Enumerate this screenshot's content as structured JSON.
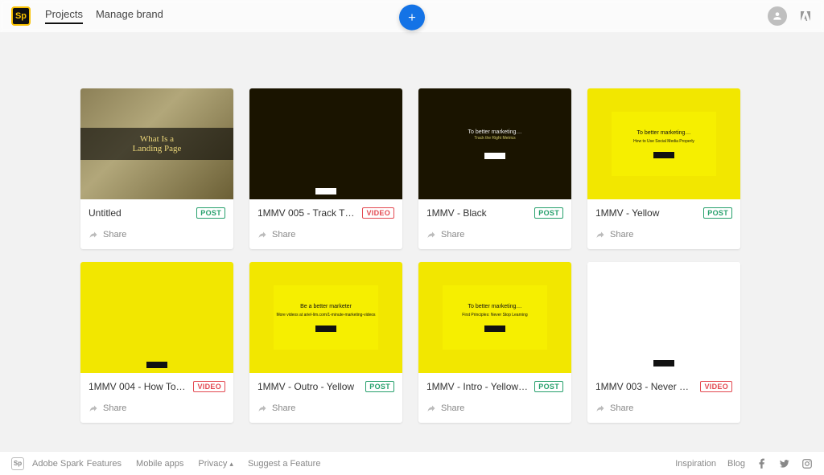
{
  "nav": {
    "logo_text": "Sp",
    "links": [
      "Projects",
      "Manage brand"
    ],
    "active_index": 0
  },
  "projects": [
    {
      "title": "Untitled",
      "badge": "POST",
      "share": "Share",
      "thumb": {
        "variant": "image",
        "heading": "What Is a\nLanding Page"
      }
    },
    {
      "title": "1MMV 005 - Track The…",
      "badge": "VIDEO",
      "share": "Share",
      "thumb": {
        "variant": "black_logo"
      }
    },
    {
      "title": "1MMV - Black",
      "badge": "POST",
      "share": "Share",
      "thumb": {
        "variant": "black_text",
        "heading": "To better marketing…",
        "sub": "Track the Right Metrics"
      }
    },
    {
      "title": "1MMV - Yellow",
      "badge": "POST",
      "share": "Share",
      "thumb": {
        "variant": "yellow_inset",
        "heading": "To better marketing…",
        "sub": "How to Use Social Media Properly"
      }
    },
    {
      "title": "1MMV 004 - How To Use…",
      "badge": "VIDEO",
      "share": "Share",
      "thumb": {
        "variant": "yellow_plain"
      }
    },
    {
      "title": "1MMV - Outro - Yellow",
      "badge": "POST",
      "share": "Share",
      "thumb": {
        "variant": "yellow_inset",
        "heading": "Be a better marketer",
        "sub": "More videos at ariel-lim.com/1-minute-marketing-videos"
      }
    },
    {
      "title": "1MMV - Intro - Yellow…",
      "badge": "POST",
      "share": "Share",
      "thumb": {
        "variant": "yellow_inset",
        "heading": "To better marketing…",
        "sub": "First Principles: Never Stop Learning"
      }
    },
    {
      "title": "1MMV 003 - Never Stop…",
      "badge": "VIDEO",
      "share": "Share",
      "thumb": {
        "variant": "white_logo"
      }
    }
  ],
  "footer": {
    "brand": "Adobe Spark",
    "links": [
      "Features",
      "Mobile apps",
      "Privacy",
      "Suggest a Feature"
    ],
    "privacy_has_menu": true,
    "right_links": [
      "Inspiration",
      "Blog"
    ]
  }
}
